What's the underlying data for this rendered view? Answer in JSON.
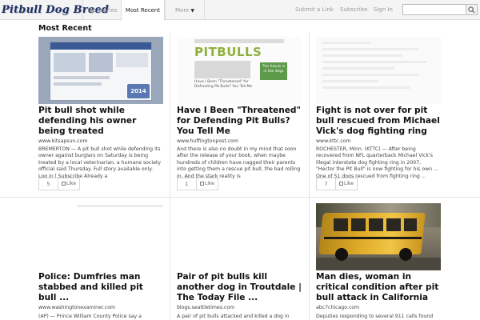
{
  "header": {
    "logo_text": "Pitbull Dog Breed",
    "tabs": [
      {
        "label": "Top Stories",
        "active": false
      },
      {
        "label": "Most Recent",
        "active": true
      },
      {
        "label": "More",
        "active": false
      }
    ],
    "links": {
      "submit": "Submit a Link",
      "subscribe": "Subscribe",
      "sign_in": "Sign In"
    },
    "search": {
      "placeholder": "",
      "icon": "search-icon"
    }
  },
  "section_title": "Most Recent",
  "like_label": "Like",
  "articles": [
    {
      "headline": "Pit bull shot while defending his owner being treated",
      "source": "www.kitsapsun.com",
      "snippet": "BREMERTON — A pit bull shot while defending its owner against burglars on Saturday is being treated by a local veterinarian, a humane society official said Thursday. Full story available only. Log in | Subscribe Already a",
      "likes": "5",
      "thumb_badge": "2014"
    },
    {
      "headline": "Have I Been \"Threatened\" for Defending Pit Bulls? You Tell Me",
      "source": "www.huffingtonpost.com",
      "snippet": "And there is also no doubt in my mind that soon after the release of your book, when maybe hundreds of children have nagged their parents into getting them a rescue pit bull, the bad rolling in. And the stark reality is",
      "likes": "1",
      "thumb_title": "PITBULLS",
      "thumb_caption": "Have I Been \"Threatened\" for Defending Pit Bulls? You Tell Me",
      "thumb_promo": "The future is in the dogs"
    },
    {
      "headline": "Fight is not over for pit bull rescued from Michael Vick's dog fighting ring",
      "source": "www.kttc.com",
      "snippet": "ROCHESTER, Minn. (KTTC) — After being recovered from NFL quarterback Michael Vick's illegal interstate dog fighting ring in 2007, \"Hector the Pit Bull\" is now fighting for his own ... One of 51 dogs rescued from fighting ring ...",
      "likes": "7"
    },
    {
      "headline": "Police: Dumfries man stabbed and killed pit bull ...",
      "source": "www.washingtonexaminer.com",
      "snippet": "(AP) — Prince William County Police say a"
    },
    {
      "headline": "Pair of pit bulls kill another dog in Troutdale | The Today File ...",
      "source": "blogs.seattletimes.com",
      "snippet": "A pair of pit bulls attacked and killed a dog in"
    },
    {
      "headline": "Man dies, woman in critical condition after pit bull attack in California",
      "source": "abc7chicago.com",
      "snippet": "Deputies responding to several 911 calls found"
    }
  ],
  "colors": {
    "logo": "#1c2f5e",
    "pitbulls_green": "#8fb13a",
    "bus_yellow": "#e0ac2a"
  }
}
